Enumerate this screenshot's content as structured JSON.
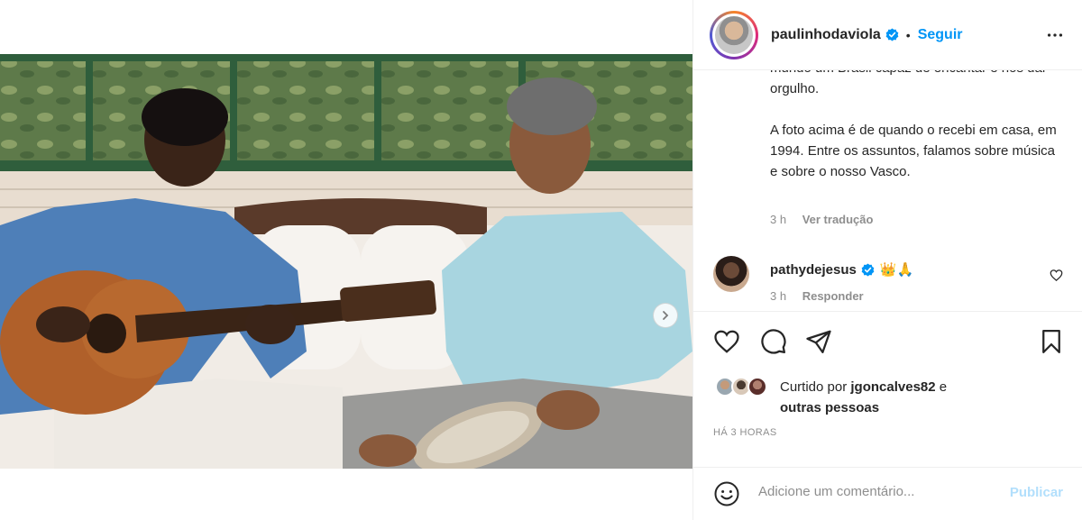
{
  "post": {
    "author": "paulinhodaviola",
    "follow_label": "Seguir",
    "separator": "•",
    "caption_lines": [
      "mundo um Brasil capaz de encantar e nos dar orgulho.",
      "A foto acima é de quando o recebi em casa, em 1994. Entre os assuntos, falamos sobre música e sobre o nosso Vasco."
    ],
    "caption_time": "3 h",
    "translate_label": "Ver tradução"
  },
  "comment": {
    "user": "pathydejesus",
    "emoji": "👑🙏",
    "time": "3 h",
    "reply_label": "Responder"
  },
  "likes": {
    "prefix": "Curtido por",
    "user": "jgoncalves82",
    "connector": "e",
    "suffix": "outras pessoas"
  },
  "time_ago": "HÁ 3 HORAS",
  "add_comment": {
    "placeholder": "Adicione um comentário...",
    "publish_label": "Publicar"
  },
  "colors": {
    "accent": "#0095f6",
    "muted": "#8e8e8e",
    "publish_disabled": "#b2dffc"
  },
  "icons": [
    "more-icon",
    "verified-icon",
    "next-icon",
    "heart-icon",
    "comment-icon",
    "share-icon",
    "bookmark-icon",
    "emoji-icon"
  ]
}
